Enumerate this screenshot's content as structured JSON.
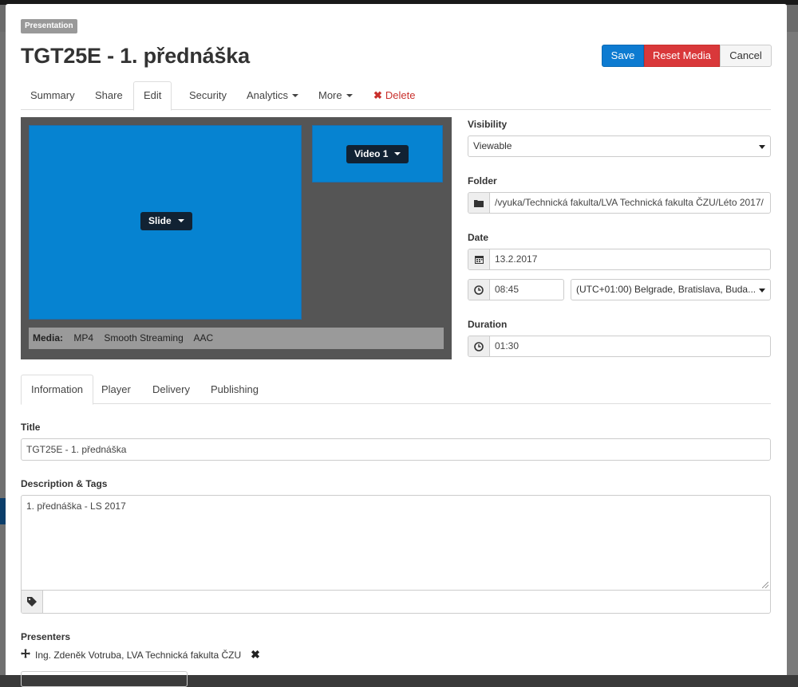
{
  "window": {
    "tag": "Presentation",
    "title": "TGT25E - 1. přednáška"
  },
  "toolbar": {
    "save_label": "Save",
    "reset_label": "Reset Media",
    "cancel_label": "Cancel"
  },
  "tabs": [
    {
      "label": "Summary"
    },
    {
      "label": "Share"
    },
    {
      "label": "Edit",
      "active": true
    },
    {
      "label": "Security"
    },
    {
      "label": "Analytics"
    },
    {
      "label": "More"
    },
    {
      "label": "Delete"
    }
  ],
  "preview": {
    "slide_label": "Slide",
    "video_label": "Video 1",
    "media_label": "Media:",
    "media_formats": [
      "MP4",
      "Smooth Streaming",
      "AAC"
    ]
  },
  "form": {
    "visibility_label": "Visibility",
    "visibility_value": "Viewable",
    "folder_label": "Folder",
    "folder_value": "/vyuka/Technická fakulta/LVA Technická fakulta ČZU/Léto 2017/",
    "date_label": "Date",
    "date_value": "13.2.2017",
    "time_value": "08:45",
    "timezone_value": "(UTC+01:00) Belgrade, Bratislava, Buda...",
    "duration_label": "Duration",
    "duration_value": "01:30"
  },
  "subtabs": [
    {
      "label": "Information",
      "active": true
    },
    {
      "label": "Player"
    },
    {
      "label": "Delivery"
    },
    {
      "label": "Publishing"
    }
  ],
  "info": {
    "title_label": "Title",
    "title_value": "TGT25E - 1. přednáška",
    "description_label": "Description & Tags",
    "description_value": "1. přednáška - LS 2017",
    "tags_value": "",
    "presenters_label": "Presenters",
    "presenter_name": "Ing. Zdeněk Votruba, LVA Technická fakulta ČZU"
  },
  "colors": {
    "accent": "#0d7bd1",
    "danger": "#d9383a",
    "preview_blue": "#0683d1",
    "preview_bg": "#555555"
  }
}
